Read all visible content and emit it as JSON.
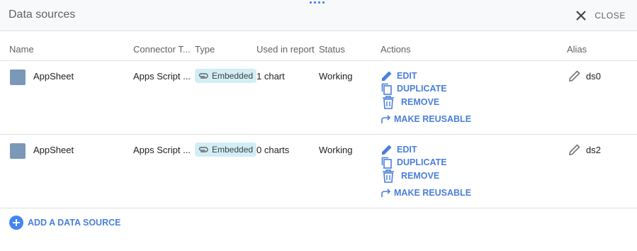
{
  "panel": {
    "title": "Data sources",
    "close_label": "CLOSE"
  },
  "columns": {
    "name": "Name",
    "connector": "Connector T...",
    "type": "Type",
    "used": "Used in report",
    "status": "Status",
    "actions": "Actions",
    "alias": "Alias"
  },
  "rows": [
    {
      "name": "AppSheet",
      "connector": "Apps Script ...",
      "type": "Embedded",
      "used": "1 chart",
      "status": "Working",
      "actions": {
        "edit": "EDIT",
        "duplicate": "DUPLICATE",
        "remove": "REMOVE",
        "make_reusable": "MAKE REUSABLE"
      },
      "alias": "ds0"
    },
    {
      "name": "AppSheet",
      "connector": "Apps Script ...",
      "type": "Embedded",
      "used": "0 charts",
      "status": "Working",
      "actions": {
        "edit": "EDIT",
        "duplicate": "DUPLICATE",
        "remove": "REMOVE",
        "make_reusable": "MAKE REUSABLE"
      },
      "alias": "ds2"
    }
  ],
  "footer": {
    "add_label": "ADD A DATA SOURCE"
  },
  "colors": {
    "accent": "#4285f4",
    "action_text": "#4a7fdb",
    "chip_bg": "#d2eef5",
    "swatch": "#7b98b8"
  }
}
